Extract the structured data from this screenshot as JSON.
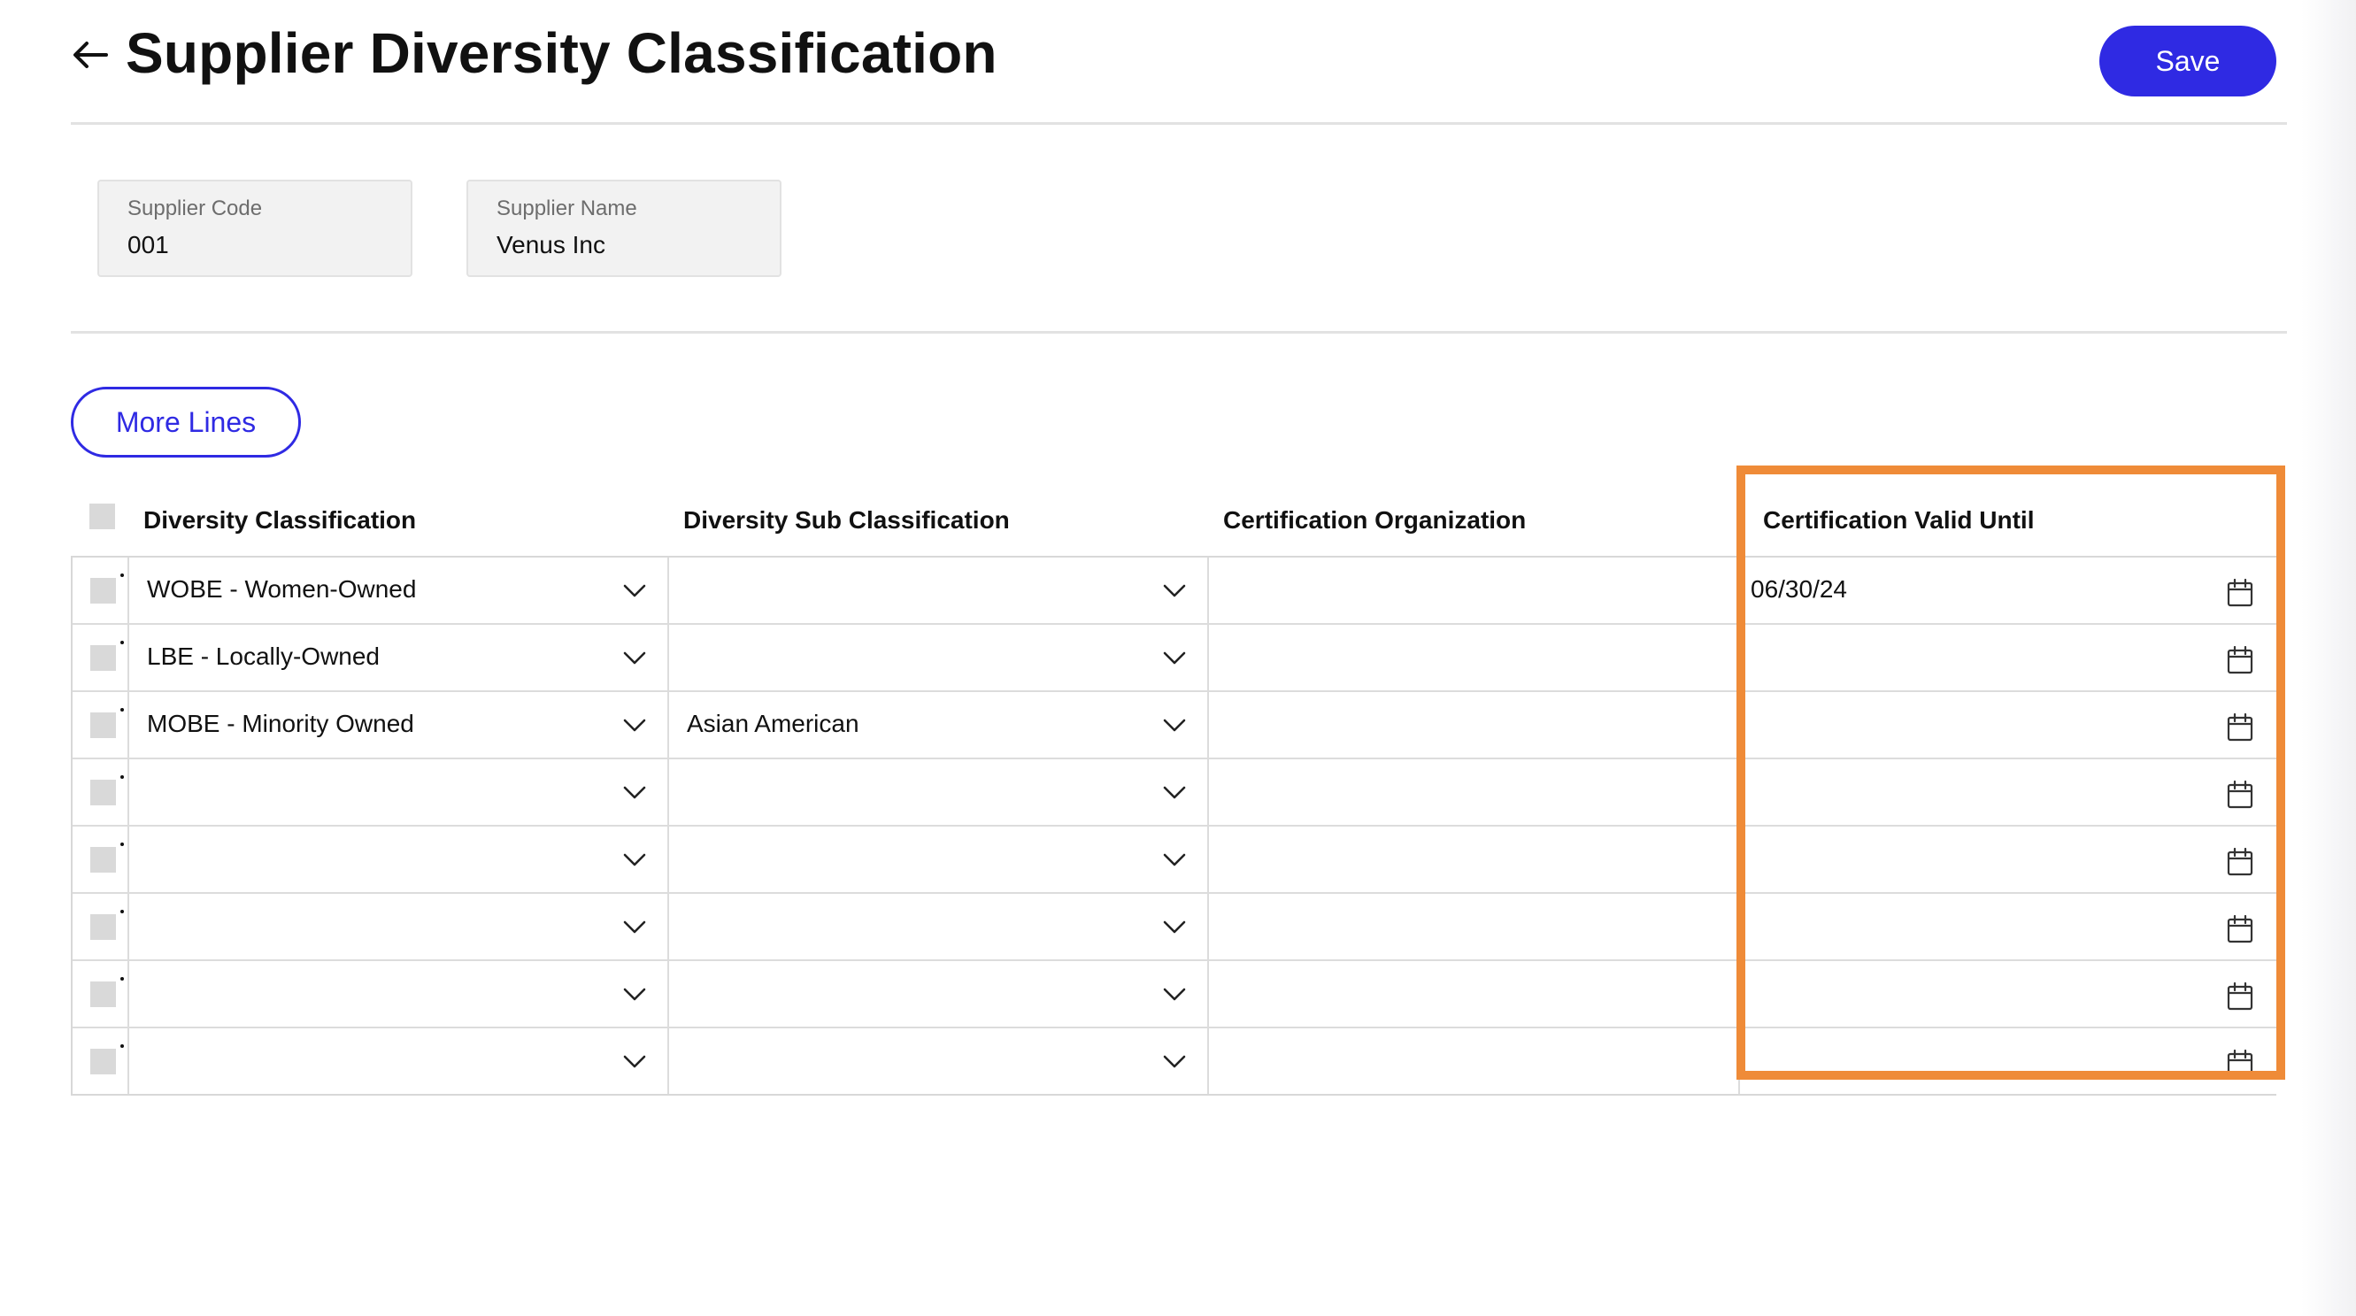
{
  "header": {
    "back_icon": "arrow-left-icon",
    "title": "Supplier Diversity Classification",
    "save_label": "Save"
  },
  "supplier": {
    "code_label": "Supplier Code",
    "code_value": "001",
    "name_label": "Supplier Name",
    "name_value": "Venus Inc"
  },
  "toolbar": {
    "more_lines_label": "More Lines"
  },
  "table": {
    "columns": [
      "Diversity Classification",
      "Diversity Sub Classification",
      "Certification Organization",
      "Certification Valid Until"
    ],
    "rows": [
      {
        "classification": "WOBE - Women-Owned",
        "sub_classification": "",
        "organization": "",
        "valid_until": "06/30/24"
      },
      {
        "classification": "LBE - Locally-Owned",
        "sub_classification": "",
        "organization": "",
        "valid_until": ""
      },
      {
        "classification": "MOBE - Minority Owned",
        "sub_classification": "Asian American",
        "organization": "",
        "valid_until": ""
      },
      {
        "classification": "",
        "sub_classification": "",
        "organization": "",
        "valid_until": ""
      },
      {
        "classification": "",
        "sub_classification": "",
        "organization": "",
        "valid_until": ""
      },
      {
        "classification": "",
        "sub_classification": "",
        "organization": "",
        "valid_until": ""
      },
      {
        "classification": "",
        "sub_classification": "",
        "organization": "",
        "valid_until": ""
      },
      {
        "classification": "",
        "sub_classification": "",
        "organization": "",
        "valid_until": ""
      }
    ],
    "dropdown_icon": "chevron-down-icon",
    "date_icon": "calendar-icon"
  },
  "colors": {
    "accent": "#2f2ae3",
    "highlight": "#ef8b38",
    "field_bg": "#f2f2f2",
    "border": "#dcdcdc"
  }
}
